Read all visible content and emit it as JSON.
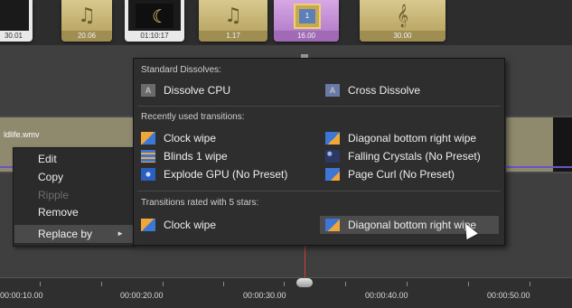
{
  "top_clips": [
    {
      "timecode": "30.01"
    },
    {
      "timecode": "20.06"
    },
    {
      "timecode": "01:10:17"
    },
    {
      "timecode": "1.17"
    },
    {
      "timecode": "16.00"
    },
    {
      "timecode": "30.00"
    }
  ],
  "timeline": {
    "clip_name": "ldlife.wmv",
    "ruler_labels": [
      "00:00:10.00",
      "00:00:20.00",
      "00:00:30.00",
      "00:00:40.00",
      "00:00:50.00"
    ]
  },
  "context_menu": {
    "items": [
      {
        "label": "Edit",
        "enabled": true
      },
      {
        "label": "Copy",
        "enabled": true
      },
      {
        "label": "Ripple",
        "enabled": false
      },
      {
        "label": "Remove",
        "enabled": true
      }
    ],
    "replace_by": "Replace by",
    "arrow": "►"
  },
  "submenu": {
    "sections": [
      {
        "title": "Standard Dissolves:",
        "items": [
          {
            "label": "Dissolve CPU",
            "icon": "dissolve-icon"
          },
          {
            "label": "Cross Dissolve",
            "icon": "cross-dissolve-icon"
          }
        ]
      },
      {
        "title": "Recently used transitions:",
        "items": [
          {
            "label": "Clock wipe",
            "icon": "clock-wipe-icon"
          },
          {
            "label": "Diagonal bottom right wipe",
            "icon": "diagonal-wipe-icon"
          },
          {
            "label": "Blinds 1 wipe",
            "icon": "blinds-wipe-icon"
          },
          {
            "label": "Falling Crystals (No Preset)",
            "icon": "falling-crystals-icon"
          },
          {
            "label": "Explode GPU (No Preset)",
            "icon": "explode-icon"
          },
          {
            "label": "Page Curl (No Preset)",
            "icon": "page-curl-icon"
          }
        ]
      },
      {
        "title": "Transitions rated with 5 stars:",
        "items": [
          {
            "label": "Clock wipe",
            "icon": "clock-wipe-icon"
          },
          {
            "label": "Diagonal bottom right wipe",
            "icon": "diagonal-wipe-icon",
            "highlighted": true
          }
        ]
      }
    ]
  },
  "colors": {
    "menu_bg": "#2e2e2e",
    "highlight": "#4c4c4c",
    "music_clip": "#b5a265",
    "title_clip": "#b57fc9",
    "playhead": "#d23c3c"
  }
}
